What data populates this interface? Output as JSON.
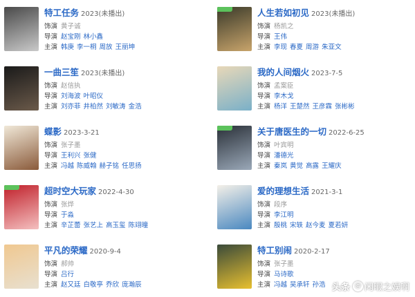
{
  "labels": {
    "producer": "饰演",
    "director": "导演",
    "cast": "主演"
  },
  "dramas": [
    {
      "title": "特工任务",
      "date": "2023(未播出)",
      "producer": "黄子诚",
      "directors": [
        "赵宝刚",
        "林小鑫"
      ],
      "cast": [
        "韩庚",
        "李一桐",
        "周放",
        "王丽坤"
      ],
      "poster_colors": [
        "#4a4a4a",
        "#c9c9c9"
      ],
      "flag": false
    },
    {
      "title": "人生若如初见",
      "date": "2023(未播出)",
      "producer": "杨凯之",
      "directors": [
        "王伟"
      ],
      "cast": [
        "李现",
        "春夏",
        "周游",
        "朱亚文"
      ],
      "poster_colors": [
        "#3a3a2a",
        "#c8a46b"
      ],
      "flag": true
    },
    {
      "title": "一曲三笙",
      "date": "2023(未播出)",
      "producer": "赵信执",
      "directors": [
        "刘海波",
        "叶昭仪"
      ],
      "cast": [
        "刘亦菲",
        "井柏然",
        "刘敏涛",
        "金浩"
      ],
      "poster_colors": [
        "#1a1a1a",
        "#6b5a4a"
      ],
      "flag": false
    },
    {
      "title": "我的人间烟火",
      "date": "2023-7-5",
      "producer": "孟案臣",
      "directors": [
        "李木戈"
      ],
      "cast": [
        "杨洋",
        "王楚然",
        "王彦霖",
        "张彬彬"
      ],
      "poster_colors": [
        "#e8d8b8",
        "#7ab0c8"
      ],
      "flag": false
    },
    {
      "title": "蝶影",
      "date": "2023-3-21",
      "producer": "张子墨",
      "directors": [
        "王利兴",
        "张健"
      ],
      "cast": [
        "冯越",
        "陈威翰",
        "赫子铭",
        "任思扬"
      ],
      "poster_colors": [
        "#f0e8d8",
        "#8a5a3a"
      ],
      "flag": false
    },
    {
      "title": "关于唐医生的一切",
      "date": "2022-6-25",
      "producer": "叶宾明",
      "directors": [
        "潘德光"
      ],
      "cast": [
        "秦岚",
        "黄觉",
        "高露",
        "王耀庆"
      ],
      "poster_colors": [
        "#2a3038",
        "#9aa8b8"
      ],
      "flag": true
    },
    {
      "title": "超时空大玩家",
      "date": "2022-4-30",
      "producer": "张烨",
      "directors": [
        "于淼"
      ],
      "cast": [
        "辛芷蕾",
        "张艺上",
        "高玉玺",
        "陈翊曈"
      ],
      "poster_colors": [
        "#c0202a",
        "#f4c0c0"
      ],
      "flag": true
    },
    {
      "title": "爱的理想生活",
      "date": "2021-3-1",
      "producer": "段序",
      "directors": [
        "李江明"
      ],
      "cast": [
        "殷桃",
        "宋轶",
        "赵今麦",
        "夏若妍"
      ],
      "poster_colors": [
        "#f4f0e8",
        "#4a88c0"
      ],
      "flag": false
    },
    {
      "title": "平凡的荣耀",
      "date": "2020-9-4",
      "producer": "郝帅",
      "directors": [
        "吕行"
      ],
      "cast": [
        "赵又廷",
        "白敬亭",
        "乔欣",
        "庞瀚辰"
      ],
      "poster_colors": [
        "#f0c890",
        "#e8e0d0"
      ],
      "flag": false
    },
    {
      "title": "特工别闹",
      "date": "2020-2-17",
      "producer": "张子墨",
      "directors": [
        "马诗歌"
      ],
      "cast": [
        "冯越",
        "吴承轩",
        "孙浩"
      ],
      "poster_colors": [
        "#3a4a3a",
        "#e8c030"
      ],
      "flag": false
    }
  ],
  "watermark": {
    "logo": "头条",
    "account": "闲暇之娱啊"
  }
}
